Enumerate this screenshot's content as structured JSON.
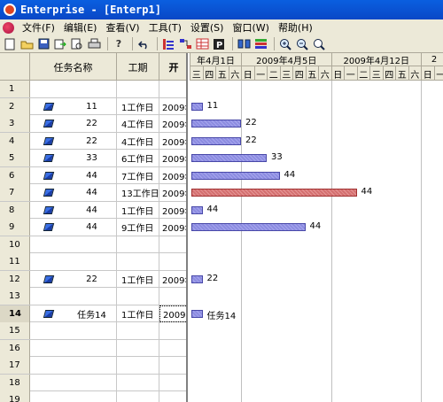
{
  "window": {
    "title": "Enterprise - [Enterp1]"
  },
  "menu": [
    "文件(F)",
    "编辑(E)",
    "查看(V)",
    "工具(T)",
    "设置(S)",
    "窗口(W)",
    "帮助(H)"
  ],
  "toolbar": {
    "icons": [
      "new-file-icon",
      "open-folder-icon",
      "save-icon",
      "export-icon",
      "print-preview-icon",
      "print-icon",
      "help-icon",
      "undo-icon",
      "task-outline-icon",
      "link-icon",
      "table-icon",
      "report-icon",
      "split-icon",
      "layout-icon",
      "zoom-in-icon",
      "zoom-out-icon",
      "find-icon"
    ]
  },
  "grid": {
    "headers": {
      "name": "任务名称",
      "duration": "工期",
      "start": "开"
    },
    "rows": [
      {
        "num": "1",
        "name": "",
        "duration": "",
        "start": "",
        "icon": false
      },
      {
        "num": "2",
        "name": "11",
        "duration": "1工作日",
        "start": "2009年",
        "icon": true
      },
      {
        "num": "3",
        "name": "22",
        "duration": "4工作日",
        "start": "2009年",
        "icon": true
      },
      {
        "num": "4",
        "name": "22",
        "duration": "4工作日",
        "start": "2009年",
        "icon": true
      },
      {
        "num": "5",
        "name": "33",
        "duration": "6工作日",
        "start": "2009年",
        "icon": true
      },
      {
        "num": "6",
        "name": "44",
        "duration": "7工作日",
        "start": "2009年",
        "icon": true
      },
      {
        "num": "7",
        "name": "44",
        "duration": "13工作日",
        "start": "2009年",
        "icon": true
      },
      {
        "num": "8",
        "name": "44",
        "duration": "1工作日",
        "start": "2009年",
        "icon": true
      },
      {
        "num": "9",
        "name": "44",
        "duration": "9工作日",
        "start": "2009年",
        "icon": true
      },
      {
        "num": "10",
        "name": "",
        "duration": "",
        "start": "",
        "icon": false
      },
      {
        "num": "11",
        "name": "",
        "duration": "",
        "start": "",
        "icon": false
      },
      {
        "num": "12",
        "name": "22",
        "duration": "1工作日",
        "start": "2009年",
        "icon": true
      },
      {
        "num": "13",
        "name": "",
        "duration": "",
        "start": "",
        "icon": false
      },
      {
        "num": "14",
        "name": "任务14",
        "duration": "1工作日",
        "start": "2009年",
        "icon": true,
        "selected": true
      },
      {
        "num": "15",
        "name": "",
        "duration": "",
        "start": "",
        "icon": false
      },
      {
        "num": "16",
        "name": "",
        "duration": "",
        "start": "",
        "icon": false
      },
      {
        "num": "17",
        "name": "",
        "duration": "",
        "start": "",
        "icon": false
      },
      {
        "num": "18",
        "name": "",
        "duration": "",
        "start": "",
        "icon": false
      },
      {
        "num": "19",
        "name": "",
        "duration": "",
        "start": "",
        "icon": false
      }
    ]
  },
  "gantt": {
    "weeks": [
      "年4月1日",
      "2009年4月5日",
      "2009年4月12日",
      "2"
    ],
    "days": [
      "三",
      "四",
      "五",
      "六",
      "日",
      "一",
      "二",
      "三",
      "四",
      "五",
      "六",
      "日",
      "一",
      "二",
      "三",
      "四",
      "五",
      "六",
      "日",
      "一"
    ],
    "bars": [
      {
        "row": 2,
        "start_day": 0,
        "days": 1,
        "label": "11",
        "color": "blue"
      },
      {
        "row": 3,
        "start_day": 0,
        "days": 4,
        "label": "22",
        "color": "blue"
      },
      {
        "row": 4,
        "start_day": 0,
        "days": 4,
        "label": "22",
        "color": "blue"
      },
      {
        "row": 5,
        "start_day": 0,
        "days": 6,
        "label": "33",
        "color": "blue"
      },
      {
        "row": 6,
        "start_day": 0,
        "days": 7,
        "label": "44",
        "color": "blue"
      },
      {
        "row": 7,
        "start_day": 0,
        "days": 13,
        "label": "44",
        "color": "red"
      },
      {
        "row": 8,
        "start_day": 0,
        "days": 1,
        "label": "44",
        "color": "blue"
      },
      {
        "row": 9,
        "start_day": 0,
        "days": 9,
        "label": "44",
        "color": "blue"
      },
      {
        "row": 12,
        "start_day": 0,
        "days": 1,
        "label": "22",
        "color": "blue"
      },
      {
        "row": 14,
        "start_day": 0,
        "days": 1,
        "label": "任务14",
        "color": "blue"
      }
    ]
  }
}
